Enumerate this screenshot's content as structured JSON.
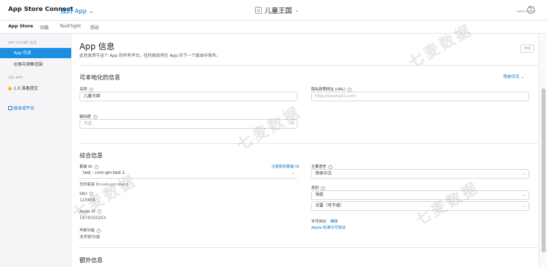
{
  "header": {
    "brand": "App Store Connect",
    "apps_menu": "我的 App ⌄",
    "app_name": "儿童王国",
    "app_chevron": "⌄",
    "user_line1": "① ⌄",
    "user_line2": "xxxx.mxxx",
    "help": "?"
  },
  "tabs": [
    {
      "label": "App Store"
    },
    {
      "label": "功能"
    },
    {
      "label": "TestFlight"
    },
    {
      "label": "活动"
    }
  ],
  "sidebar": {
    "section1": "APP STORE 信息",
    "item_app_info": "App 信息",
    "item_pricing": "价格与销售范围",
    "section2": "iOS APP",
    "item_version": "1.0 准备提交",
    "item_add_platform": "版本或平台"
  },
  "main": {
    "title": "App 信息",
    "description": "此信息用于这个 App 的所有平台。任何更改将在 App 的下一个版本中发布。",
    "save_label": "存储",
    "localizable": {
      "title": "可本地化的信息",
      "language": "简体中文 ⌄",
      "name_label": "名称",
      "name_value": "儿童王国",
      "privacy_label": "隐私政策网址 (URL)",
      "privacy_placeholder": "http://example.com",
      "subtitle_label": "副标题",
      "subtitle_placeholder": "可选",
      "subtitle_counter": "30"
    },
    "general": {
      "title": "综合信息",
      "bundle_label": "套装 ID",
      "bundle_link": "注册新的套装 ID",
      "bundle_value": "test - com.qm.test.1",
      "bundle_id_text": "您的套装 ID:com.qm.test.1",
      "sku_label": "SKU",
      "sku_value": "123456",
      "apple_id_label": "Apple ID",
      "apple_id_value": "1474333253",
      "age_label": "年龄分级",
      "age_value": "无年龄分级",
      "primary_lang_label": "主要语言",
      "primary_lang_value": "简体中文",
      "category_label": "类别",
      "category_primary": "导航",
      "category_secondary": "次要（可不填）",
      "license_label": "许可协议",
      "license_edit": "编辑",
      "license_value": "Apple 标准许可协议"
    },
    "additional": {
      "title": "额外信息"
    }
  },
  "watermark": "七麦数据"
}
